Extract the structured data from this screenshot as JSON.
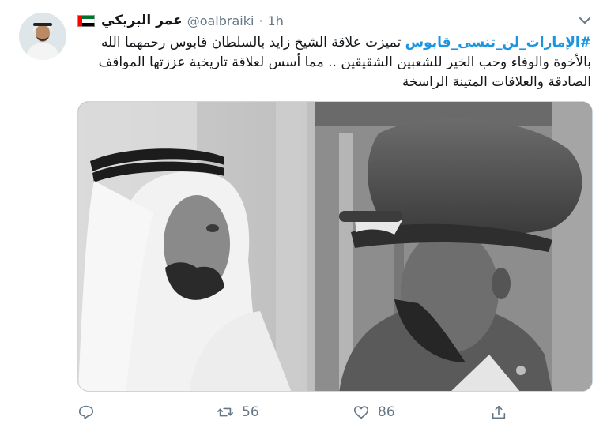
{
  "tweet": {
    "author": {
      "display_name": "عمر البريكي",
      "handle": "@oalbraiki",
      "separator": "·",
      "time": "1h",
      "flag_icon": "uae-flag-icon"
    },
    "text": {
      "hashtag": "#الإمارات_لن_تنسى_قابوس",
      "body": " تميزت علاقة الشيخ زايد بالسلطان قابوس رحمهما الله بالأخوة والوفاء وحب الخير للشعبين الشقيقين .. مما أسس لعلاقة تاريخية عززتها المواقف الصادقة والعلاقات المتينة الراسخة"
    },
    "media": {
      "type": "photo",
      "style": "black-and-white"
    },
    "actions": {
      "reply_icon": "reply-icon",
      "retweet_icon": "retweet-icon",
      "retweet_count": "56",
      "like_icon": "like-icon",
      "like_count": "86",
      "share_icon": "share-icon"
    },
    "colors": {
      "link": "#1b95e0",
      "secondary_text": "#657786",
      "primary_text": "#14171a"
    }
  }
}
